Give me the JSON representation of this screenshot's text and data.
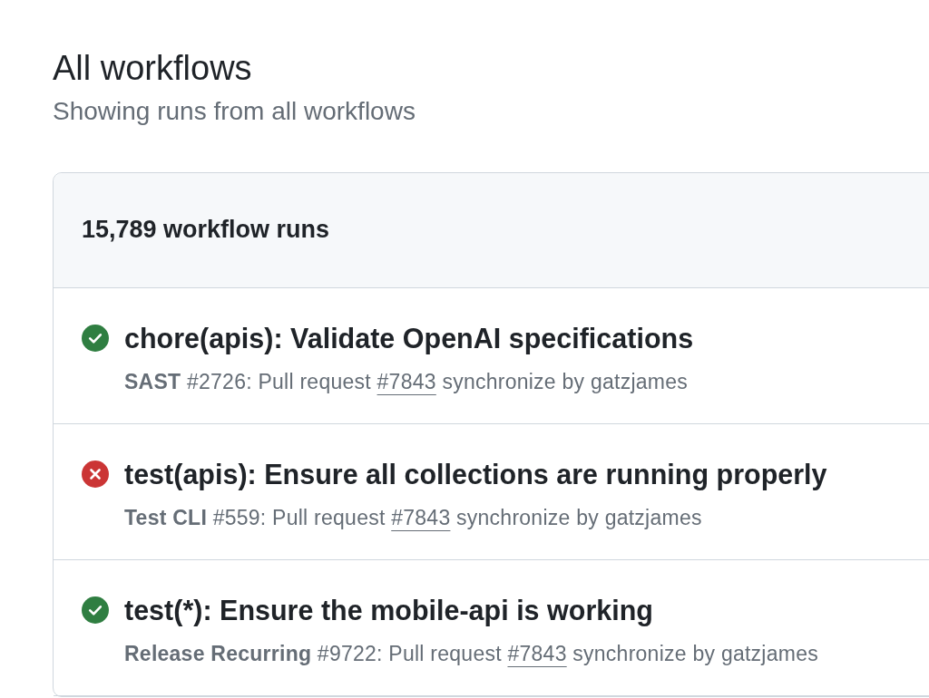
{
  "page": {
    "title": "All workflows",
    "subtitle": "Showing runs from all workflows"
  },
  "runs_box": {
    "count": "15,789 workflow runs"
  },
  "runs": [
    {
      "kind": "success",
      "title": "chore(apis): Validate OpenAI specifications",
      "meta_before": "**SAST** #2726: Pull request",
      "pr_link": "#7843",
      "meta_after": "synchronize by gatzjames"
    },
    {
      "kind": "failure",
      "title": "test(apis): Ensure all collections are running properly",
      "meta_before": "**Test CLI** #559: Pull request",
      "pr_link": "#7843",
      "meta_after": "synchronize by gatzjames"
    },
    {
      "kind": "success",
      "title": "test(*): Ensure the mobile-api is working",
      "meta_before": "**Release Recurring** #9722: Pull request",
      "pr_link": "#7843",
      "meta_after": "synchronize by gatzjames"
    }
  ]
}
